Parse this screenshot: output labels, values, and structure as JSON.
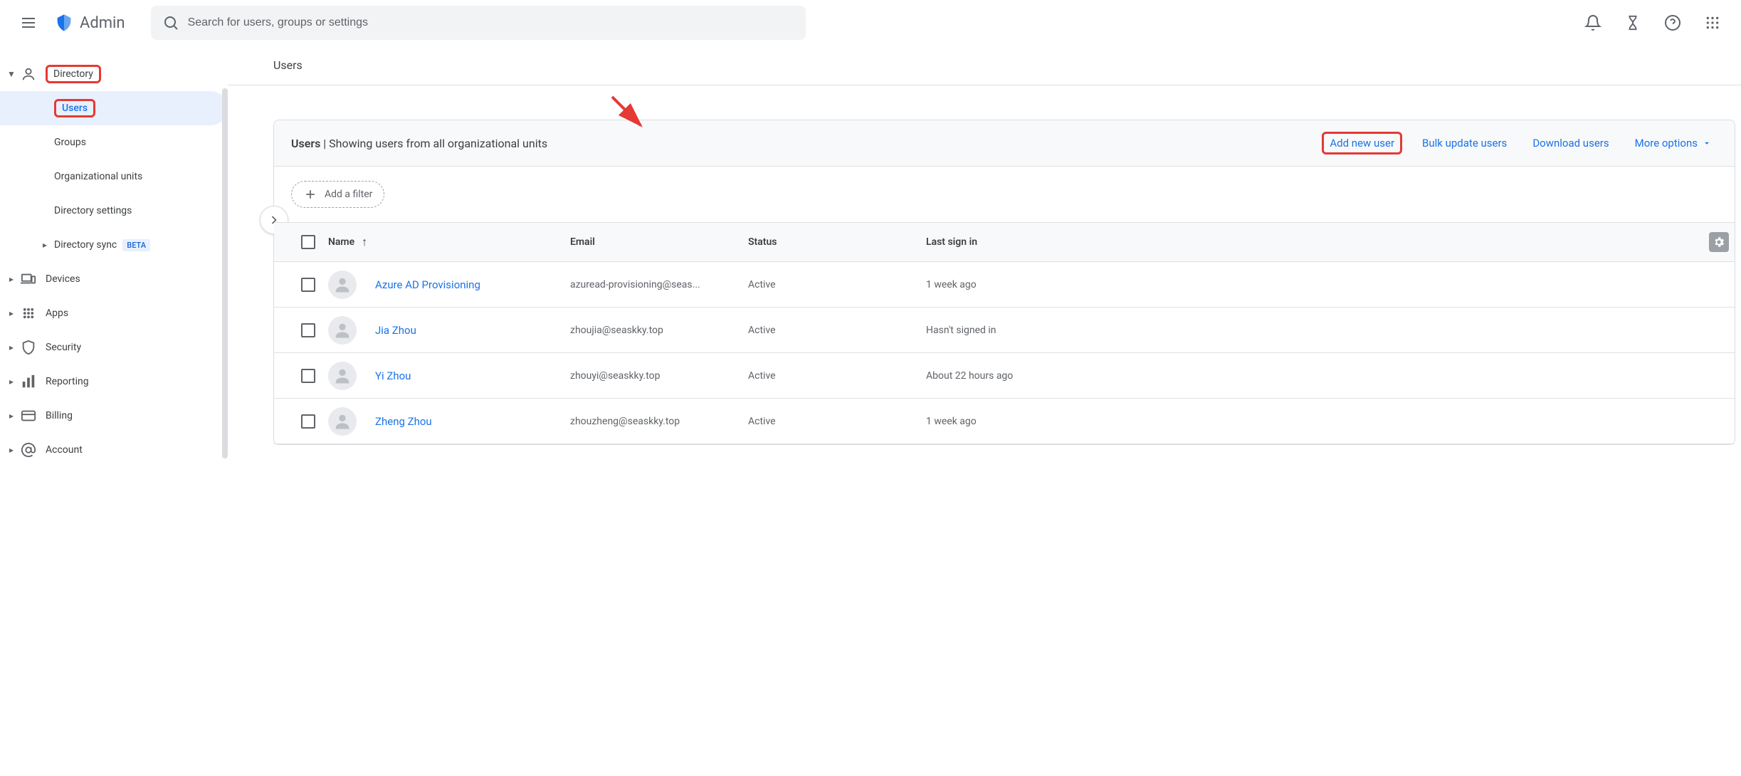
{
  "header": {
    "app_name": "Admin",
    "search_placeholder": "Search for users, groups or settings"
  },
  "sidebar": {
    "directory_label": "Directory",
    "users_label": "Users",
    "groups_label": "Groups",
    "org_units_label": "Organizational units",
    "dir_settings_label": "Directory settings",
    "dir_sync_label": "Directory sync",
    "dir_sync_badge": "BETA",
    "devices_label": "Devices",
    "apps_label": "Apps",
    "security_label": "Security",
    "reporting_label": "Reporting",
    "billing_label": "Billing",
    "account_label": "Account"
  },
  "breadcrumb": {
    "users": "Users"
  },
  "panel": {
    "title_bold": "Users",
    "title_rest": " | Showing users from all organizational units",
    "add_new_user": "Add new user",
    "bulk_update": "Bulk update users",
    "download": "Download users",
    "more_options": "More options",
    "add_filter": "Add a filter"
  },
  "columns": {
    "name": "Name",
    "email": "Email",
    "status": "Status",
    "last_sign_in": "Last sign in"
  },
  "users": [
    {
      "name": "Azure AD Provisioning",
      "email": "azuread-provisioning@seas...",
      "status": "Active",
      "last_sign_in": "1 week ago"
    },
    {
      "name": "Jia Zhou",
      "email": "zhoujia@seaskky.top",
      "status": "Active",
      "last_sign_in": "Hasn't signed in"
    },
    {
      "name": "Yi Zhou",
      "email": "zhouyi@seaskky.top",
      "status": "Active",
      "last_sign_in": "About 22 hours ago"
    },
    {
      "name": "Zheng Zhou",
      "email": "zhouzheng@seaskky.top",
      "status": "Active",
      "last_sign_in": "1 week ago"
    }
  ]
}
